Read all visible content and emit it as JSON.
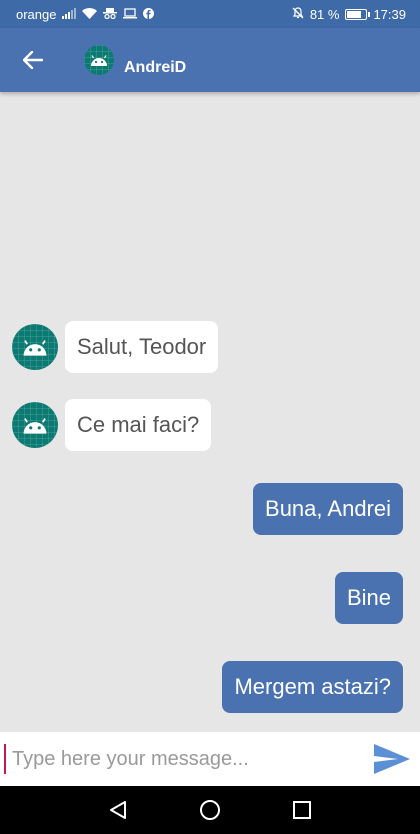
{
  "status_bar": {
    "carrier": "orange",
    "battery_percent": "81 %",
    "battery_level": 0.81,
    "time": "17:39",
    "icons": [
      "signal-icon",
      "wifi-icon",
      "incognito-icon",
      "laptop-icon",
      "facebook-icon",
      "mute-icon",
      "battery-icon"
    ]
  },
  "header": {
    "contact_name": "AndreiD",
    "back_icon": "arrow-back-icon",
    "avatar_icon": "android-avatar-icon",
    "bar_color": "#4a72b0"
  },
  "messages": [
    {
      "direction": "incoming",
      "text": "Salut, Teodor"
    },
    {
      "direction": "incoming",
      "text": "Ce mai faci?"
    },
    {
      "direction": "outgoing",
      "text": "Buna, Andrei"
    },
    {
      "direction": "outgoing",
      "text": "Bine"
    },
    {
      "direction": "outgoing",
      "text": "Mergem astazi?"
    }
  ],
  "composer": {
    "placeholder": "Type here your message...",
    "value": "",
    "send_icon": "send-icon",
    "send_color": "#5b8fd6"
  },
  "nav_bar": {
    "icons": [
      "nav-back-icon",
      "nav-home-icon",
      "nav-recents-icon"
    ]
  }
}
